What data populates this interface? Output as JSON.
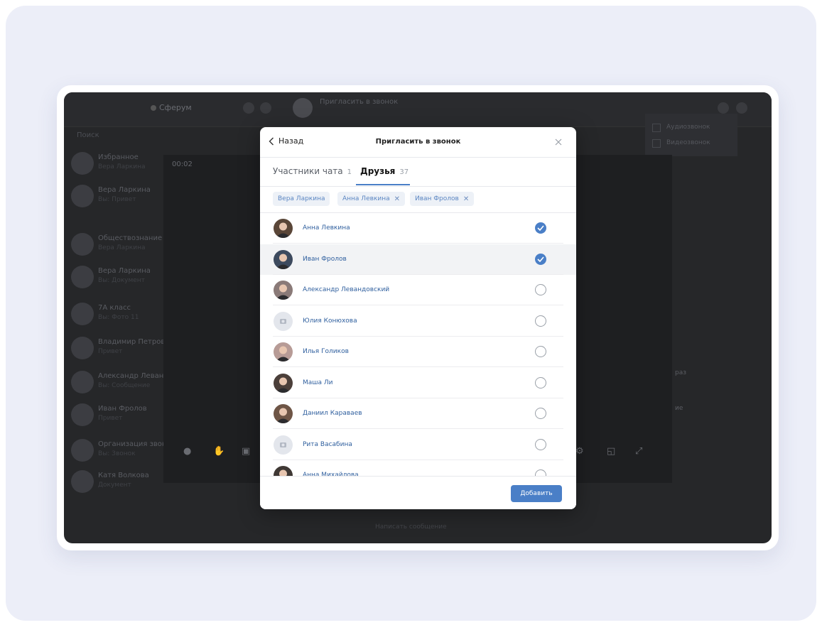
{
  "modal": {
    "back_label": "Назад",
    "title": "Пригласить в звонок",
    "tabs": [
      {
        "label": "Участники чата",
        "count": "1",
        "active": false
      },
      {
        "label": "Друзья",
        "count": "37",
        "active": true
      }
    ],
    "chips": [
      {
        "label": "Вера Ларкина",
        "removable": false
      },
      {
        "label": "Анна Левкина",
        "removable": true
      },
      {
        "label": "Иван Фролов",
        "removable": true
      }
    ],
    "contacts": [
      {
        "name": "Анна Левкина",
        "checked": true
      },
      {
        "name": "Иван Фролов",
        "checked": true
      },
      {
        "name": "Александр Левандовский",
        "checked": false
      },
      {
        "name": "Юлия Конюхова",
        "checked": false
      },
      {
        "name": "Илья Голиков",
        "checked": false
      },
      {
        "name": "Маша Ли",
        "checked": false
      },
      {
        "name": "Даниил Караваев",
        "checked": false
      },
      {
        "name": "Рита Васабина",
        "checked": false
      },
      {
        "name": "Анна Михайлова",
        "checked": false
      }
    ],
    "add_button": "Добавить"
  },
  "background": {
    "brand": "Сферум",
    "chat_title": "Пригласить в звонок",
    "timer": "00:02",
    "side_search": "Поиск",
    "side_items": [
      {
        "name": "Избранное",
        "msg": "Вера Ларкина"
      },
      {
        "name": "Вера Ларкина",
        "msg": "Вы: Привет"
      },
      {
        "name": "Обществознание",
        "msg": "Вера Ларкина"
      },
      {
        "name": "Вера Ларкина",
        "msg": "Вы: Документ"
      },
      {
        "name": "7А класс",
        "msg": "Вы: Фото 11"
      },
      {
        "name": "Владимир Петров",
        "msg": "Привет"
      },
      {
        "name": "Александр Левандовский",
        "msg": "Вы: Сообщение"
      },
      {
        "name": "Иван Фролов",
        "msg": "Привет"
      },
      {
        "name": "Организация звонка",
        "msg": "Вы: Звонок"
      },
      {
        "name": "Катя Волкова",
        "msg": "Документ"
      }
    ],
    "right_menu": [
      "Аудиозвонок",
      "Видеозвонок"
    ],
    "right_snips": [
      "раз",
      "ие"
    ],
    "bottom_input": "Написать сообщение"
  }
}
